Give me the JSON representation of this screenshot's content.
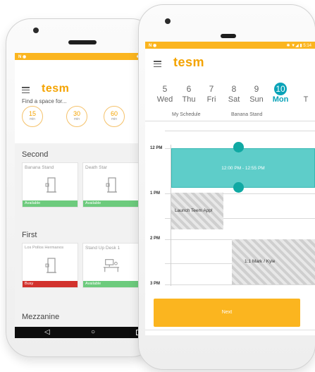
{
  "left_phone": {
    "status": {
      "left": "N ◉",
      "right": "✱ ▼"
    },
    "app_logo": "tesm",
    "prompt": "Find a space for...",
    "durations": [
      {
        "value": "15",
        "unit": "min"
      },
      {
        "value": "30",
        "unit": "min"
      },
      {
        "value": "60",
        "unit": "min"
      }
    ],
    "sections": [
      {
        "title": "Second",
        "rooms": [
          {
            "name": "Banana Stand",
            "status": "Available"
          },
          {
            "name": "Death Star",
            "status": "Available"
          }
        ]
      },
      {
        "title": "First",
        "rooms": [
          {
            "name": "Los Pollos Hermanos",
            "status": "Busy"
          },
          {
            "name": "Stand Up Desk 1",
            "status": "Available"
          }
        ]
      },
      {
        "title": "Mezzanine"
      }
    ],
    "nav": {
      "back": "◁",
      "home": "○"
    },
    "colors": {
      "available": "#6dcb7d",
      "busy": "#d2322d"
    }
  },
  "right_phone": {
    "status": {
      "left": "N ◉",
      "right": "✱ ▼◢ ▮ 5:14"
    },
    "app_logo": "tesm",
    "dates": [
      {
        "num": "5",
        "day": "Wed"
      },
      {
        "num": "6",
        "day": "Thu"
      },
      {
        "num": "7",
        "day": "Fri"
      },
      {
        "num": "8",
        "day": "Sat"
      },
      {
        "num": "9",
        "day": "Sun"
      },
      {
        "num": "10",
        "day": "Mon"
      },
      {
        "num": "",
        "day": "T"
      }
    ],
    "subtabs": [
      "My Schedule",
      "Banana Stand"
    ],
    "times": [
      "12 PM",
      "1 PM",
      "2 PM",
      "3 PM"
    ],
    "booking": "12:00 PM - 12:55 PM",
    "events": [
      "Launch Teem App!",
      "1:1 Mark / Kyle"
    ],
    "next_label": "Next",
    "colors": {
      "accent": "#0aa3b8",
      "booking": "#5ecdc9",
      "brand": "#fbb51f"
    }
  }
}
